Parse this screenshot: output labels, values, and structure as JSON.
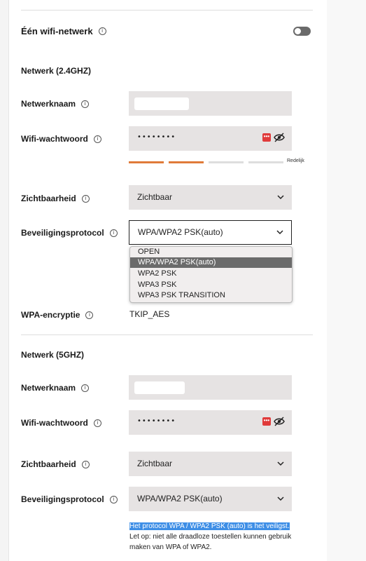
{
  "single_network": {
    "title": "Één wifi-netwerk",
    "toggle_on": false
  },
  "net24": {
    "title": "Netwerk (2.4GHZ)",
    "ssid_label": "Netwerknaam",
    "password_label": "Wifi-wachtwoord",
    "password_mask": "••••••••",
    "strength_label": "Redelijk",
    "strength_level": 2,
    "strength_total": 4,
    "visibility_label": "Zichtbaarheid",
    "visibility_value": "Zichtbaar",
    "security_label": "Beveiligingsprotocol",
    "security_value": "WPA/WPA2 PSK(auto)",
    "security_options": [
      "OPEN",
      "WPA/WPA2 PSK(auto)",
      "WPA2 PSK",
      "WPA3 PSK",
      "WPA3 PSK TRANSITION"
    ],
    "security_selected_index": 1,
    "encryption_label": "WPA-encryptie",
    "encryption_value": "TKIP_AES"
  },
  "net5": {
    "title": "Netwerk (5GHZ)",
    "ssid_label": "Netwerknaam",
    "password_label": "Wifi-wachtwoord",
    "password_mask": "••••••••",
    "visibility_label": "Zichtbaarheid",
    "visibility_value": "Zichtbaar",
    "security_label": "Beveiligingsprotocol",
    "security_value": "WPA/WPA2 PSK(auto)",
    "hint_highlight": "Het protocol WPA / WPA2 PSK (auto) is het veiligst.",
    "hint_rest": "Let op: niet alle draadloze toestellen kunnen gebruik maken van WPA of WPA2."
  },
  "icons": {
    "info": "i",
    "password_generate": "•••"
  },
  "colors": {
    "accent": "#e07b39",
    "bar_empty": "#dedede",
    "selection": "#3d8ee6",
    "toggle_off": "#6a6a6a"
  }
}
